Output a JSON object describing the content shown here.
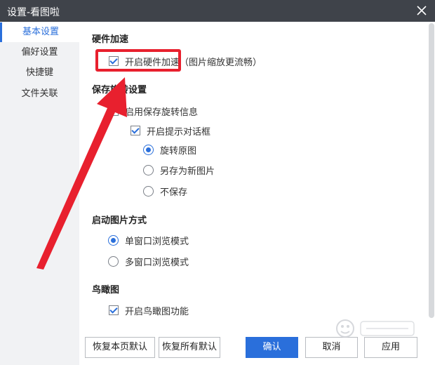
{
  "window": {
    "title": "设置-看图啦"
  },
  "sidebar": {
    "items": [
      {
        "label": "基本设置",
        "active": true
      },
      {
        "label": "偏好设置",
        "active": false
      },
      {
        "label": "快捷键",
        "active": false
      },
      {
        "label": "文件关联",
        "active": false
      }
    ]
  },
  "hardware": {
    "title": "硬件加速",
    "option": {
      "label": "开启硬件加速（图片缩放更流畅）",
      "checked": true
    }
  },
  "rotate": {
    "title": "保存旋转设置",
    "enable": {
      "label": "启用保存旋转信息",
      "checked": false
    },
    "prompt": {
      "label": "开启提示对话框",
      "checked": true
    },
    "radios": [
      {
        "label": "旋转原图",
        "checked": true
      },
      {
        "label": "另存为新图片",
        "checked": false
      },
      {
        "label": "不保存",
        "checked": false
      }
    ]
  },
  "launch": {
    "title": "启动图片方式",
    "radios": [
      {
        "label": "单窗口浏览模式",
        "checked": true
      },
      {
        "label": "多窗口浏览模式",
        "checked": false
      }
    ]
  },
  "birdview": {
    "title": "鸟瞰图",
    "option": {
      "label": "开启鸟瞰图功能",
      "checked": true
    }
  },
  "footer": {
    "restore_page": "恢复本页默认",
    "restore_all": "恢复所有默认",
    "ok": "确认",
    "cancel": "取消",
    "apply": "应用"
  },
  "colors": {
    "accent": "#2a6fdb",
    "annotation": "#e8202e",
    "titlebar": "#3f434a"
  },
  "icons": {
    "close": "close-icon",
    "annotation": "red-arrow"
  }
}
